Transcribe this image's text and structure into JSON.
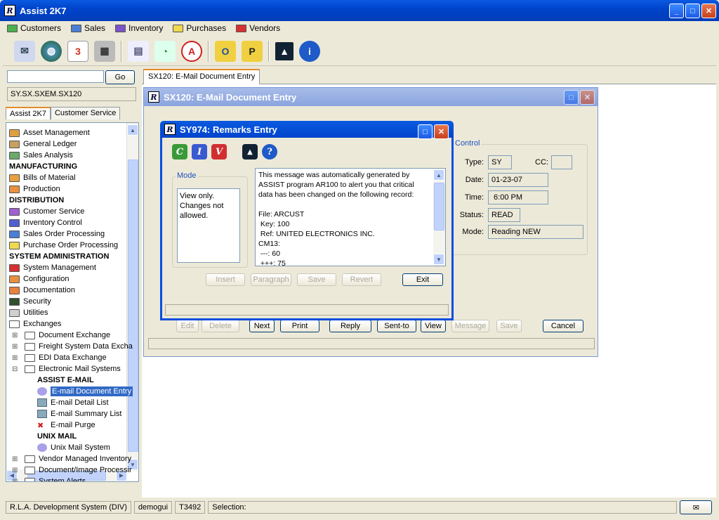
{
  "app": {
    "title": "Assist 2K7"
  },
  "menu": [
    {
      "label": "Customers",
      "color": "#4cb04c"
    },
    {
      "label": "Sales",
      "color": "#4a7fd6"
    },
    {
      "label": "Inventory",
      "color": "#7b55c8"
    },
    {
      "label": "Purchases",
      "color": "#f0d850"
    },
    {
      "label": "Vendors",
      "color": "#d83030"
    }
  ],
  "toolbar_icons": [
    "mail-icon",
    "globe-icon",
    "calendar-icon",
    "calculator-icon",
    "document-icon",
    "chart-icon",
    "acrobat-icon",
    "outlook-icon",
    "p-icon",
    "image-icon",
    "info-icon"
  ],
  "left": {
    "search_button": "Go",
    "path": "SY.SX.SXEM.SX120",
    "tabs": [
      "Assist 2K7",
      "Customer Service"
    ],
    "tree": [
      {
        "label": "Asset Management",
        "type": "folder",
        "color": "#e0a040",
        "indent": 0
      },
      {
        "label": "General Ledger",
        "type": "folder",
        "color": "#c8a060",
        "indent": 0
      },
      {
        "label": "Sales Analysis",
        "type": "folder",
        "color": "#6aaa6a",
        "indent": 0
      },
      {
        "label": "MANUFACTURING",
        "type": "header",
        "indent": 0
      },
      {
        "label": "Bills of Material",
        "type": "folder",
        "color": "#e8a040",
        "indent": 0
      },
      {
        "label": "Production",
        "type": "folder",
        "color": "#e89040",
        "indent": 0
      },
      {
        "label": "DISTRIBUTION",
        "type": "header",
        "indent": 0
      },
      {
        "label": "Customer Service",
        "type": "folder",
        "color": "#a060d0",
        "indent": 0
      },
      {
        "label": "Inventory Control",
        "type": "folder",
        "color": "#5060d0",
        "indent": 0
      },
      {
        "label": "Sales Order Processing",
        "type": "folder",
        "color": "#4a7fd6",
        "indent": 0
      },
      {
        "label": "Purchase Order Processing",
        "type": "folder",
        "color": "#f0d850",
        "indent": 0
      },
      {
        "label": "SYSTEM ADMINISTRATION",
        "type": "header",
        "indent": 0
      },
      {
        "label": "System Management",
        "type": "folder",
        "color": "#d83030",
        "indent": 0
      },
      {
        "label": "Configuration",
        "type": "folder",
        "color": "#e89040",
        "indent": 0
      },
      {
        "label": "Documentation",
        "type": "folder",
        "color": "#e88040",
        "indent": 0
      },
      {
        "label": "Security",
        "type": "folder",
        "color": "#305030",
        "indent": 0
      },
      {
        "label": "Utilities",
        "type": "folder",
        "color": "#d0d0d0",
        "indent": 0
      },
      {
        "label": "Exchanges",
        "type": "folder",
        "color": "#ffffff",
        "indent": 0
      },
      {
        "label": "Document Exchange",
        "type": "folder",
        "color": "#ffffff",
        "indent": 1
      },
      {
        "label": "Freight System Data Excha",
        "type": "folder",
        "color": "#ffffff",
        "indent": 1
      },
      {
        "label": "EDI Data Exchange",
        "type": "folder",
        "color": "#ffffff",
        "indent": 1
      },
      {
        "label": "Electronic Mail Systems",
        "type": "folder",
        "color": "#ffffff",
        "indent": 1
      },
      {
        "label": "ASSIST E-MAIL",
        "type": "header",
        "indent": 2
      },
      {
        "label": "E-mail Document Entry",
        "type": "item",
        "indent": 2,
        "selected": true
      },
      {
        "label": "E-mail Detail List",
        "type": "item",
        "indent": 2
      },
      {
        "label": "E-mail Summary List",
        "type": "item",
        "indent": 2
      },
      {
        "label": "E-mail Purge",
        "type": "item",
        "indent": 2
      },
      {
        "label": "UNIX MAIL",
        "type": "header",
        "indent": 2
      },
      {
        "label": "Unix Mail System",
        "type": "item",
        "indent": 2
      },
      {
        "label": "Vendor Managed Inventory",
        "type": "folder",
        "color": "#ffffff",
        "indent": 1
      },
      {
        "label": "Document/Image Processir",
        "type": "folder",
        "color": "#ffffff",
        "indent": 1
      },
      {
        "label": "System Alerts",
        "type": "folder",
        "color": "#ffffff",
        "indent": 1
      }
    ]
  },
  "doc_tab": "SX120: E-Mail Document Entry",
  "sx120": {
    "title": "SX120: E-Mail Document Entry",
    "control_title": "Control",
    "fields": {
      "type_label": "Type:",
      "type": "SY",
      "cc_label": "CC:",
      "cc": "",
      "date_label": "Date:",
      "date": "01-23-07",
      "time_label": "Time:",
      "time": " 6:00 PM",
      "status_label": "Status:",
      "status": "READ",
      "mode_label": "Mode:",
      "mode": "Reading NEW"
    },
    "buttons": [
      {
        "label": "Edit",
        "enabled": false
      },
      {
        "label": "Delete",
        "enabled": false
      },
      {
        "label": "Next",
        "enabled": true
      },
      {
        "label": "Print",
        "enabled": true
      },
      {
        "label": "Reply",
        "enabled": true
      },
      {
        "label": "Sent-to",
        "enabled": true
      },
      {
        "label": "View",
        "enabled": true
      },
      {
        "label": "Message",
        "enabled": false
      },
      {
        "label": "Save",
        "enabled": false
      },
      {
        "label": "Cancel",
        "enabled": true
      }
    ]
  },
  "sy974": {
    "title": "SY974: Remarks Entry",
    "mode_title": "Mode",
    "mode_text": "View only.\nChanges not\nallowed.",
    "message": "This message was automatically generated by\nASSIST program AR100 to alert you that critical\ndata has been changed on the following record:\n\nFile: ARCUST\n Key: 100\n Ref: UNITED ELECTRONICS INC.\nCM13:\n ---: 60\n +++: 75",
    "buttons": [
      {
        "label": "Insert",
        "enabled": false
      },
      {
        "label": "Paragraph",
        "enabled": false
      },
      {
        "label": "Save",
        "enabled": false
      },
      {
        "label": "Revert",
        "enabled": false
      },
      {
        "label": "Exit",
        "enabled": true
      }
    ]
  },
  "status": {
    "system": "R.L.A. Development System (DIV)",
    "user": "demogui",
    "terminal": "T3492",
    "selection": "Selection:"
  }
}
